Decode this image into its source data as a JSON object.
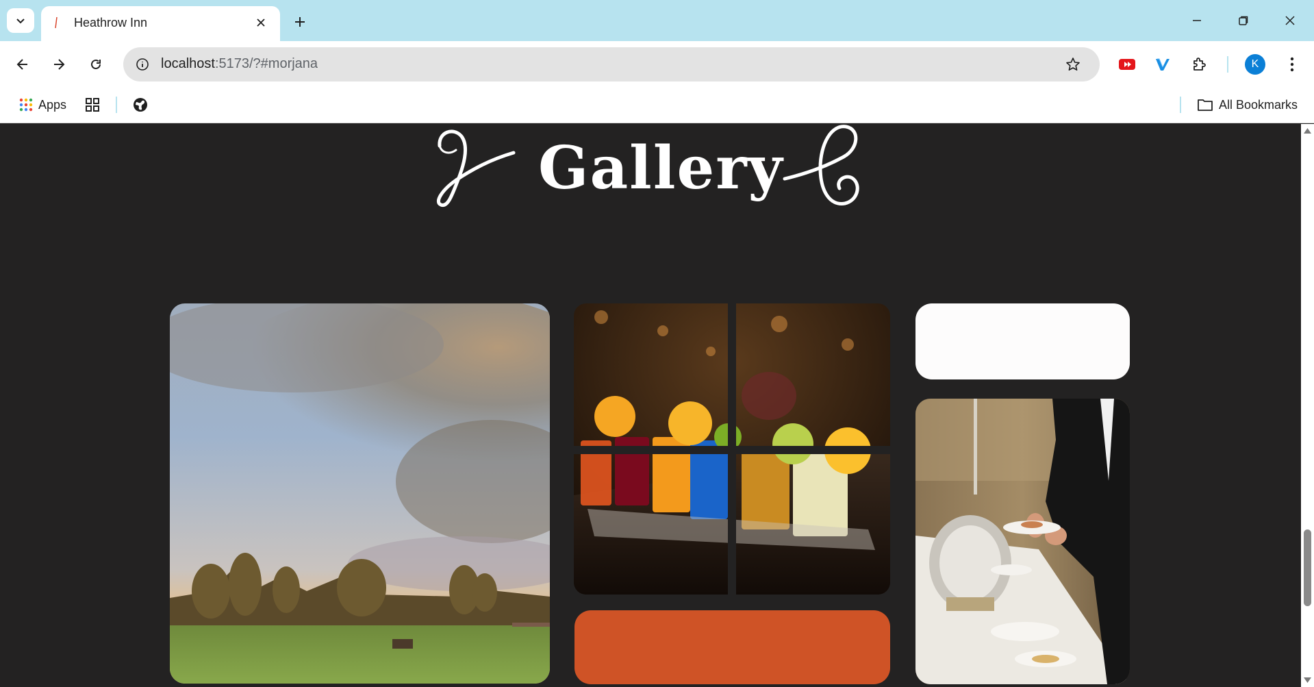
{
  "browser": {
    "tab_title": "Heathrow Inn",
    "url_host": "localhost",
    "url_rest": ":5173/?#morjana",
    "avatar_letter": "K",
    "bookmarks": {
      "apps_label": "Apps",
      "all_bookmarks_label": "All Bookmarks"
    },
    "icons": [
      "tab-list-icon",
      "close-icon",
      "plus-icon",
      "minimize-icon",
      "restore-icon",
      "window-close-icon",
      "back-arrow-icon",
      "forward-arrow-icon",
      "reload-icon",
      "info-icon",
      "star-icon",
      "youtube-extension-icon",
      "vimeo-extension-icon",
      "puzzle-icon",
      "kebab-menu-icon",
      "apps-grid-icon",
      "tab-grid-icon",
      "globe-icon",
      "folder-icon"
    ]
  },
  "page": {
    "section_title": "Gallery",
    "tiles": [
      {
        "name": "landscape-photo",
        "subject": "sunset sky over field and trees"
      },
      {
        "name": "cocktails-photo",
        "subject": "colorful shot glasses on bar"
      },
      {
        "name": "blank-white-tile",
        "color": "#fdfcfc"
      },
      {
        "name": "buffet-photo",
        "subject": "waiter serving buffet"
      },
      {
        "name": "orange-tile",
        "color": "#cf5326"
      }
    ]
  },
  "colors": {
    "tabbar": "#b7e3ef",
    "page_background": "#232222",
    "accent_orange": "#cf5326",
    "avatar_blue": "#0b7fd6"
  }
}
